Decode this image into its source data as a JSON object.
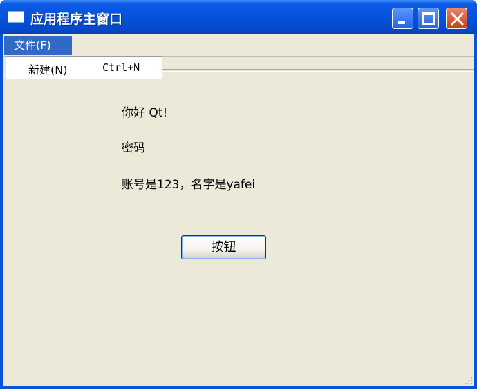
{
  "window": {
    "title": "应用程序主窗口"
  },
  "menubar": {
    "file_label": "文件(F)"
  },
  "file_menu": {
    "items": [
      {
        "label": "新建(N)",
        "shortcut": "Ctrl+N"
      }
    ]
  },
  "content": {
    "label_hello": "你好 Qt!",
    "label_password": "密码",
    "label_account": "账号是123，名字是yafei",
    "button_label": "按钮"
  },
  "colors": {
    "titlebar": "#0553d9",
    "menu_highlight": "#316ac5",
    "client_bg": "#ece9d8",
    "close_button": "#c63e18"
  },
  "icons": [
    "window-app-icon",
    "minimize-icon",
    "maximize-icon",
    "close-icon",
    "resize-grip-icon"
  ]
}
